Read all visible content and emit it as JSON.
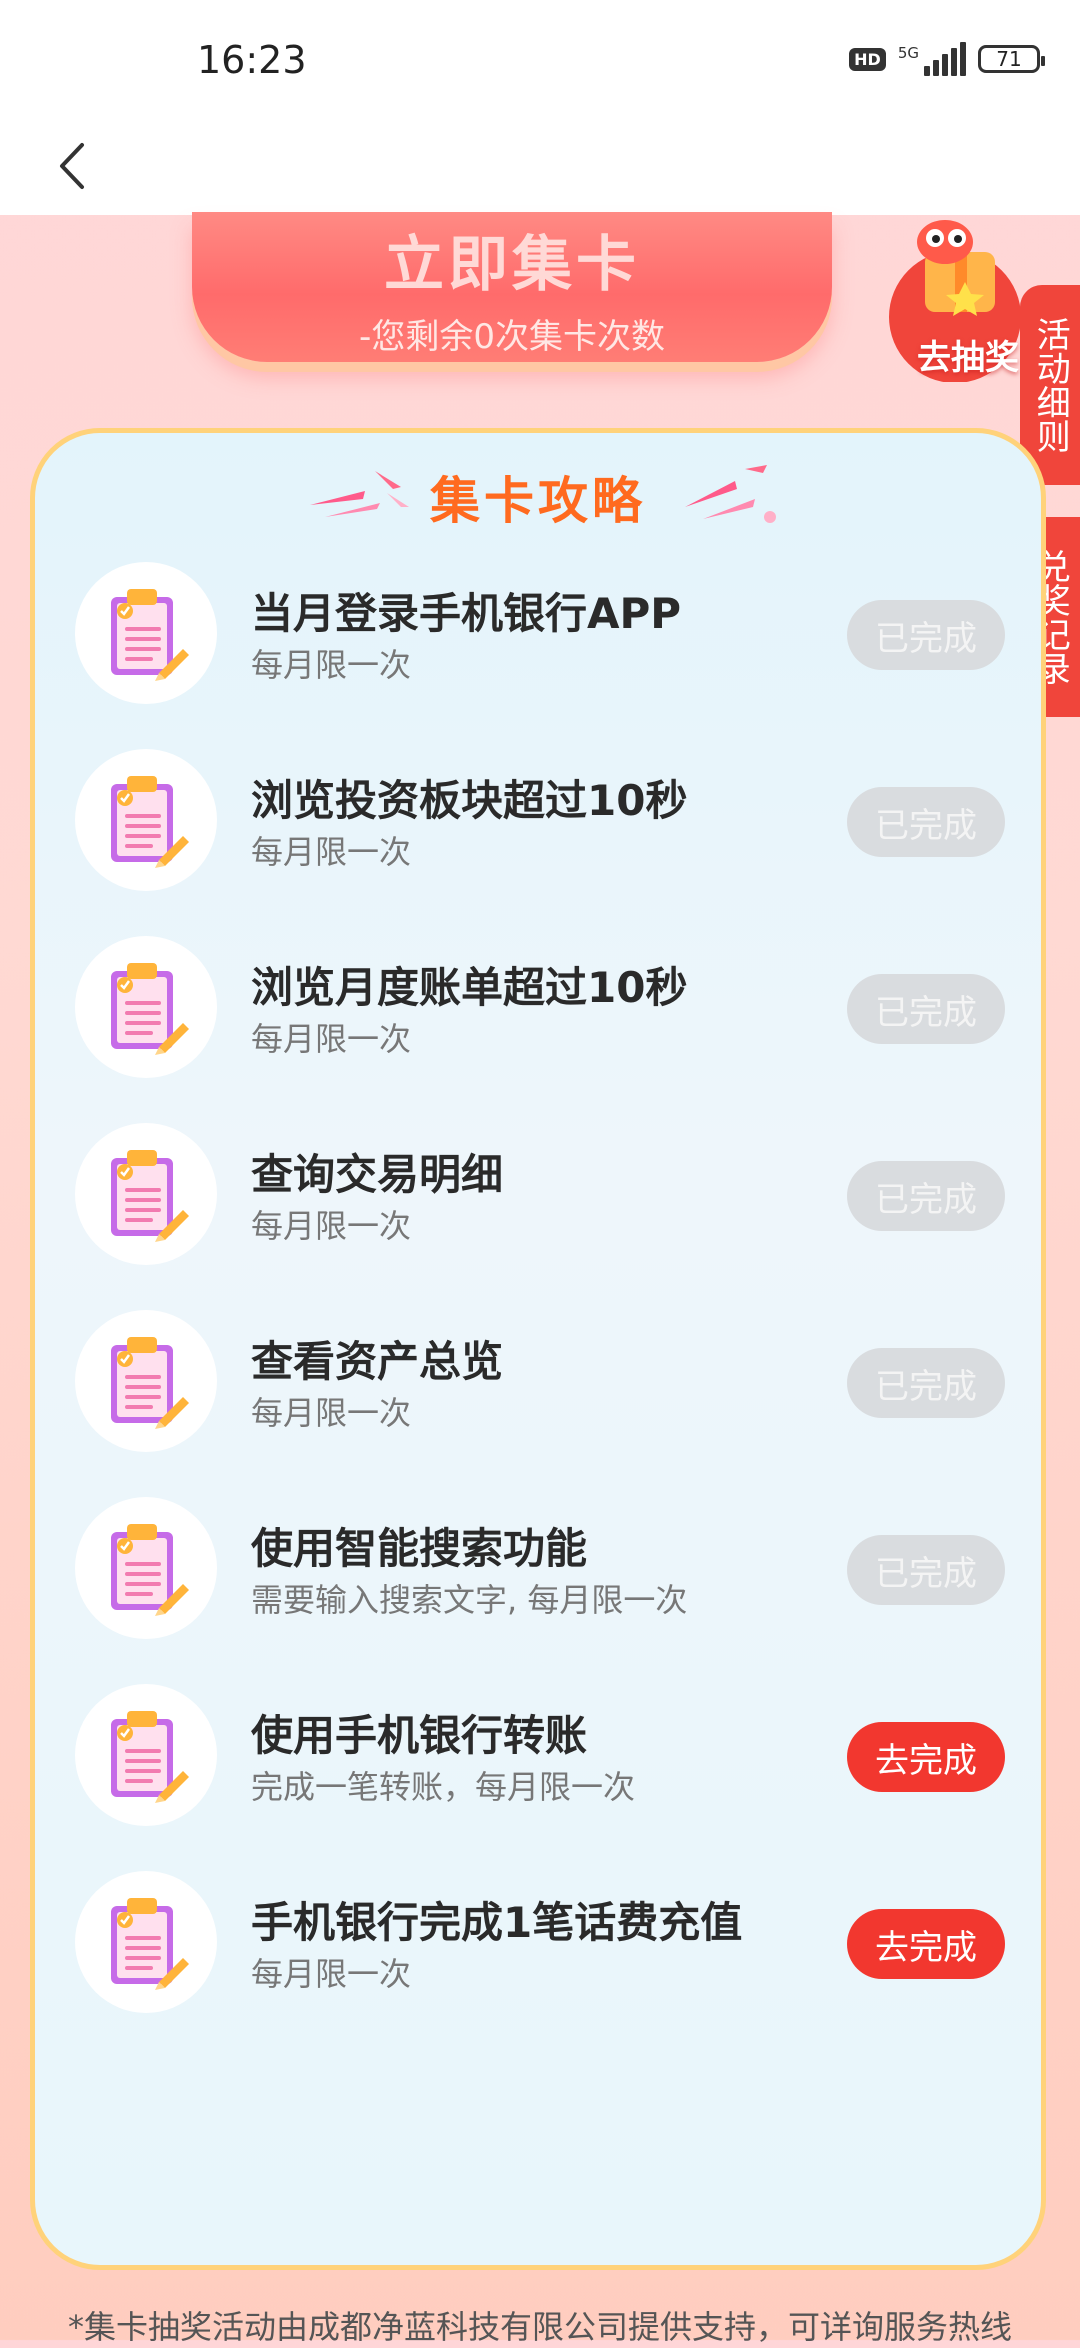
{
  "status_bar": {
    "time": "16:23",
    "hd": "HD",
    "network": "5G",
    "battery": "71"
  },
  "collect": {
    "title": "立即集卡",
    "subtitle": "-您剩余0次集卡次数"
  },
  "lottery": {
    "label": "去抽奖"
  },
  "side_tabs": {
    "rules": "活动细则",
    "records": "兑奖记录"
  },
  "guide": {
    "title": "集卡攻略",
    "tasks": [
      {
        "title": "当月登录手机银行APP",
        "subtitle": "每月限一次",
        "button": "已完成",
        "state": "done"
      },
      {
        "title": "浏览投资板块超过10秒",
        "subtitle": "每月限一次",
        "button": "已完成",
        "state": "done"
      },
      {
        "title": "浏览月度账单超过10秒",
        "subtitle": "每月限一次",
        "button": "已完成",
        "state": "done"
      },
      {
        "title": "查询交易明细",
        "subtitle": "每月限一次",
        "button": "已完成",
        "state": "done"
      },
      {
        "title": "查看资产总览",
        "subtitle": "每月限一次",
        "button": "已完成",
        "state": "done"
      },
      {
        "title": "使用智能搜索功能",
        "subtitle": "需要输入搜索文字, 每月限一次",
        "button": "已完成",
        "state": "done"
      },
      {
        "title": "使用手机银行转账",
        "subtitle": "完成一笔转账，每月限一次",
        "button": "去完成",
        "state": "todo"
      },
      {
        "title": "手机银行完成1笔话费充值",
        "subtitle": "每月限一次",
        "button": "去完成",
        "state": "todo"
      }
    ]
  },
  "footer": {
    "note": "*集卡抽奖活动由成都净蓝科技有限公司提供支持，可详询服务热线"
  },
  "colors": {
    "accent_red": "#f2372f",
    "done_gray": "#d9dcdf",
    "title_orange": "#ff6a1f",
    "panel_border": "#ffd27a"
  }
}
